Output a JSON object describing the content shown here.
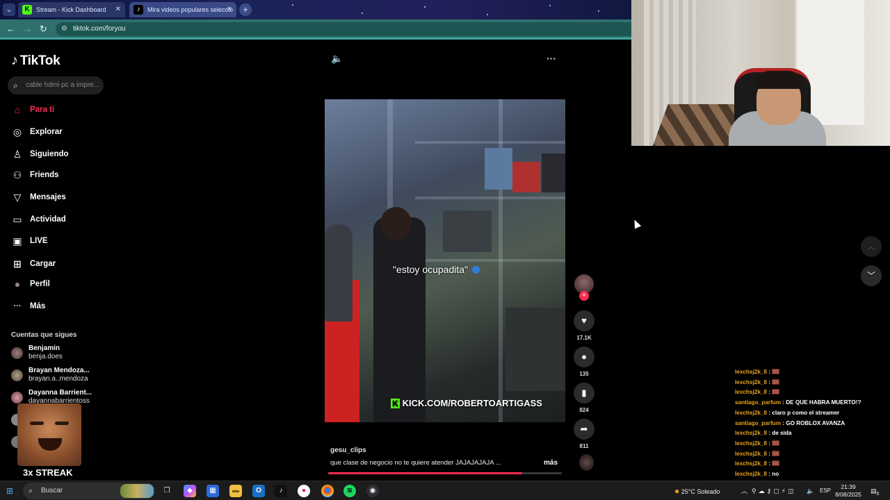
{
  "browser": {
    "tabs": [
      {
        "title": "Stream - Kick Dashboard",
        "favicon": "K"
      },
      {
        "title": "Mira videos populares seleccio",
        "favicon": "♪"
      }
    ],
    "url": "tiktok.com/foryou"
  },
  "sidebar": {
    "brand": "TikTok",
    "search_placeholder": "cable hdmi pc a impre...",
    "nav": [
      {
        "label": "Para ti",
        "icon": "home-icon",
        "glyph": "⌂",
        "active": true
      },
      {
        "label": "Explorar",
        "icon": "compass-icon",
        "glyph": "◎"
      },
      {
        "label": "Siguiendo",
        "icon": "person-icon",
        "glyph": "♙"
      },
      {
        "label": "Friends",
        "icon": "friends-icon",
        "glyph": "⚇"
      },
      {
        "label": "Mensajes",
        "icon": "send-icon",
        "glyph": "▽"
      },
      {
        "label": "Actividad",
        "icon": "activity-icon",
        "glyph": "▭"
      },
      {
        "label": "LIVE",
        "icon": "live-icon",
        "glyph": "▣"
      },
      {
        "label": "Cargar",
        "icon": "upload-icon",
        "glyph": "⊞"
      },
      {
        "label": "Perfil",
        "icon": "profile-icon",
        "glyph": "●"
      },
      {
        "label": "Más",
        "icon": "more-icon",
        "glyph": "···"
      }
    ],
    "following_title": "Cuentas que sigues",
    "following": [
      {
        "name": "Benjamin",
        "handle": "benja.does"
      },
      {
        "name": "Brayan Mendoza...",
        "handle": "brayan.a..mendoza"
      },
      {
        "name": "Dayanna Barrient...",
        "handle": "dayannabarrientoss"
      }
    ],
    "overlay_streak": "3x STREAK"
  },
  "video": {
    "caption": "\"estoy ocupadita\"",
    "watermark": "KICK.COM/ROBERTOARTIGASS",
    "username": "gesu_clips",
    "description": "que clase de negocio no te quiere atender JAJAJAJAJA  ...",
    "more_label": "más",
    "progress": 0.83,
    "likes": "17.1K",
    "comments": "135",
    "saves": "824",
    "shares": "811"
  },
  "chat": [
    {
      "user": "lexchsj2k_8",
      "text": "",
      "emote": true
    },
    {
      "user": "lexchsj2k_8",
      "text": "",
      "emote": true
    },
    {
      "user": "lexchsj2k_8",
      "text": "",
      "emote": true
    },
    {
      "user": "santiago_parfum",
      "text": "DE QUE HABRA MUERTO!?",
      "emote": false
    },
    {
      "user": "lexchsj2k_8",
      "text": "claro p como el streamer",
      "emote": false
    },
    {
      "user": "santiago_parfum",
      "text": "GO ROBLOX AVANZA",
      "emote": false
    },
    {
      "user": "lexchsj2k_8",
      "text": "de sida",
      "emote": false
    },
    {
      "user": "lexchsj2k_8",
      "text": "",
      "emote": true
    },
    {
      "user": "lexchsj2k_8",
      "text": "",
      "emote": true
    },
    {
      "user": "lexchsj2k_8",
      "text": "",
      "emote": true
    },
    {
      "user": "lexchsj2k_8",
      "text": "no",
      "emote": false
    }
  ],
  "taskbar": {
    "search_label": "Buscar",
    "weather": "25°C  Soleado",
    "language": "ESP",
    "time": "21:39",
    "date": "8/08/2025",
    "notifications": "5"
  },
  "colors": {
    "accent": "#fe2c55",
    "kick_green": "#53fc18",
    "chat_user": "#e8a31c",
    "address_bar": "#2f6f6c"
  }
}
